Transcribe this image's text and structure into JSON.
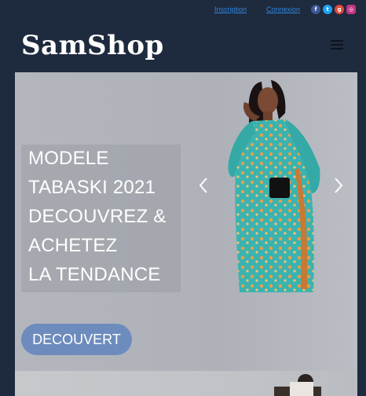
{
  "topbar": {
    "inscription": "Inscription",
    "connexion": "Connexion",
    "social_icons": [
      "facebook-icon",
      "twitter-icon",
      "google-plus-icon",
      "instagram-icon"
    ],
    "social_colors": [
      "#3b5998",
      "#1da1f2",
      "#dd4b39",
      "#c13584"
    ]
  },
  "header": {
    "brand": "SamShop",
    "menu_icon": "hamburger-menu-icon"
  },
  "hero": {
    "caption_lines": [
      "MODELE",
      "TABASKI 2021",
      "DECOUVREZ &",
      "ACHETEZ",
      "LA TENDANCE"
    ],
    "cta_label": "DECOUVERT",
    "prev_icon": "chevron-left-icon",
    "next_icon": "chevron-right-icon"
  },
  "colors": {
    "background": "#1e2a3d",
    "cta": "#6d8cbd",
    "link": "#2e86de"
  }
}
